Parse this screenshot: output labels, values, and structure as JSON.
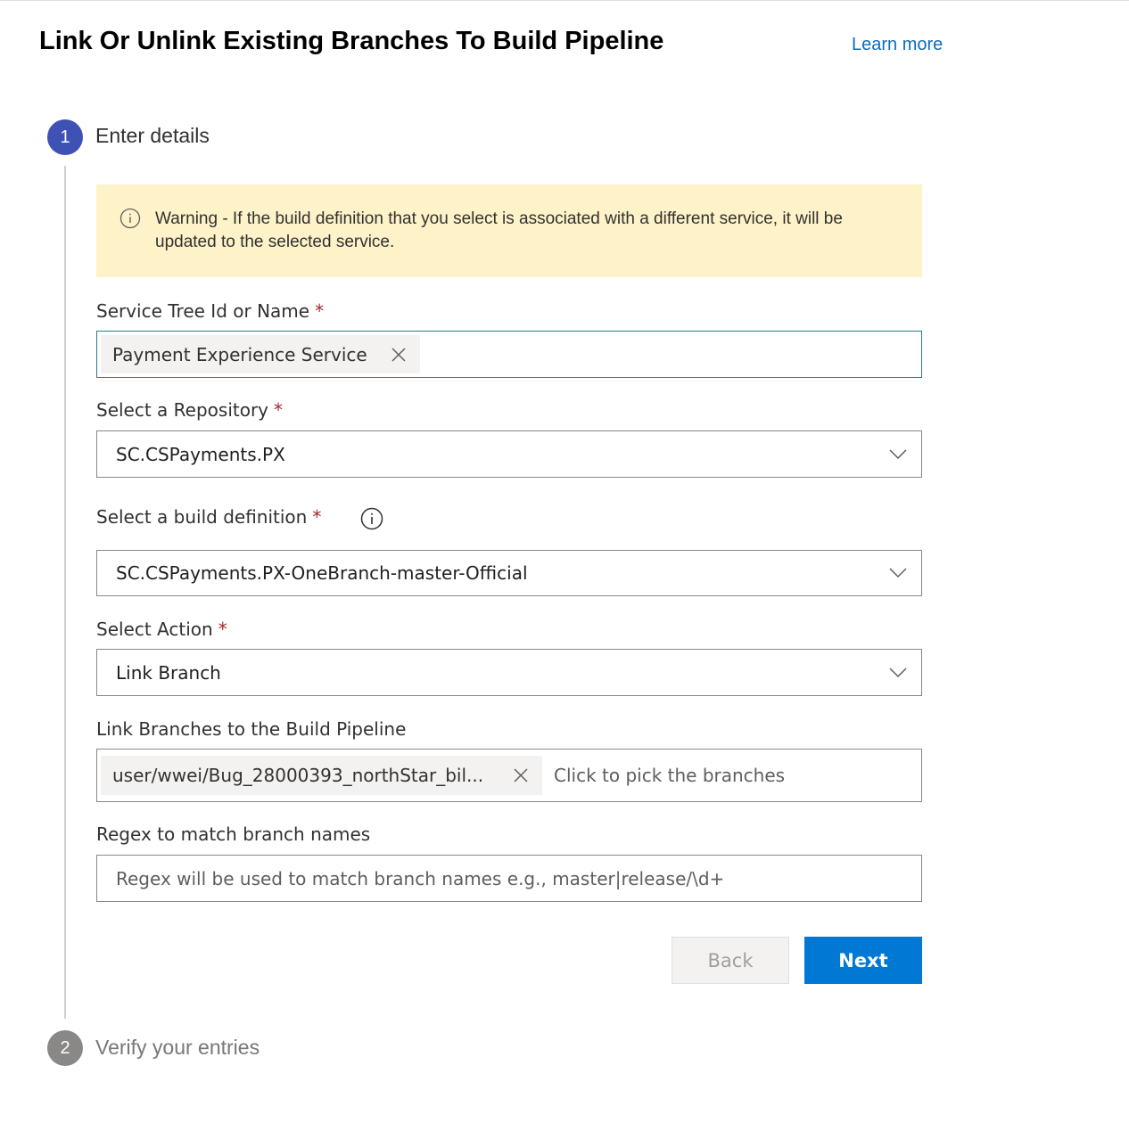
{
  "header": {
    "title": "Link Or Unlink Existing Branches To Build Pipeline",
    "learn_more": "Learn more"
  },
  "steps": [
    {
      "number": "1",
      "label": "Enter details",
      "state": "active"
    },
    {
      "number": "2",
      "label": "Verify your entries",
      "state": "inactive"
    }
  ],
  "warning": {
    "icon": "info-icon",
    "text": "Warning - If the build definition that you select is associated with a different service, it will be updated to the selected service."
  },
  "form": {
    "service": {
      "label": "Service Tree Id or Name",
      "required_mark": "*",
      "tag": "Payment Experience Service"
    },
    "repository": {
      "label": "Select a Repository",
      "required_mark": "*",
      "value": "SC.CSPayments.PX"
    },
    "build_definition": {
      "label": "Select a build definition",
      "required_mark": "*",
      "value": "SC.CSPayments.PX-OneBranch-master-Official"
    },
    "action": {
      "label": "Select Action",
      "required_mark": "*",
      "value": "Link Branch"
    },
    "branches": {
      "label": "Link Branches to the Build Pipeline",
      "tag": "user/wwei/Bug_28000393_northStar_bil...",
      "placeholder": "Click to pick the branches"
    },
    "regex": {
      "label": "Regex to match branch names",
      "placeholder": "Regex will be used to match branch names e.g., master|release/\\d+"
    }
  },
  "buttons": {
    "back": "Back",
    "next": "Next"
  },
  "colors": {
    "accent": "#0078d4",
    "step_active": "#3f51b5",
    "warning_bg": "#fdf2c8",
    "required": "#a4262c"
  }
}
